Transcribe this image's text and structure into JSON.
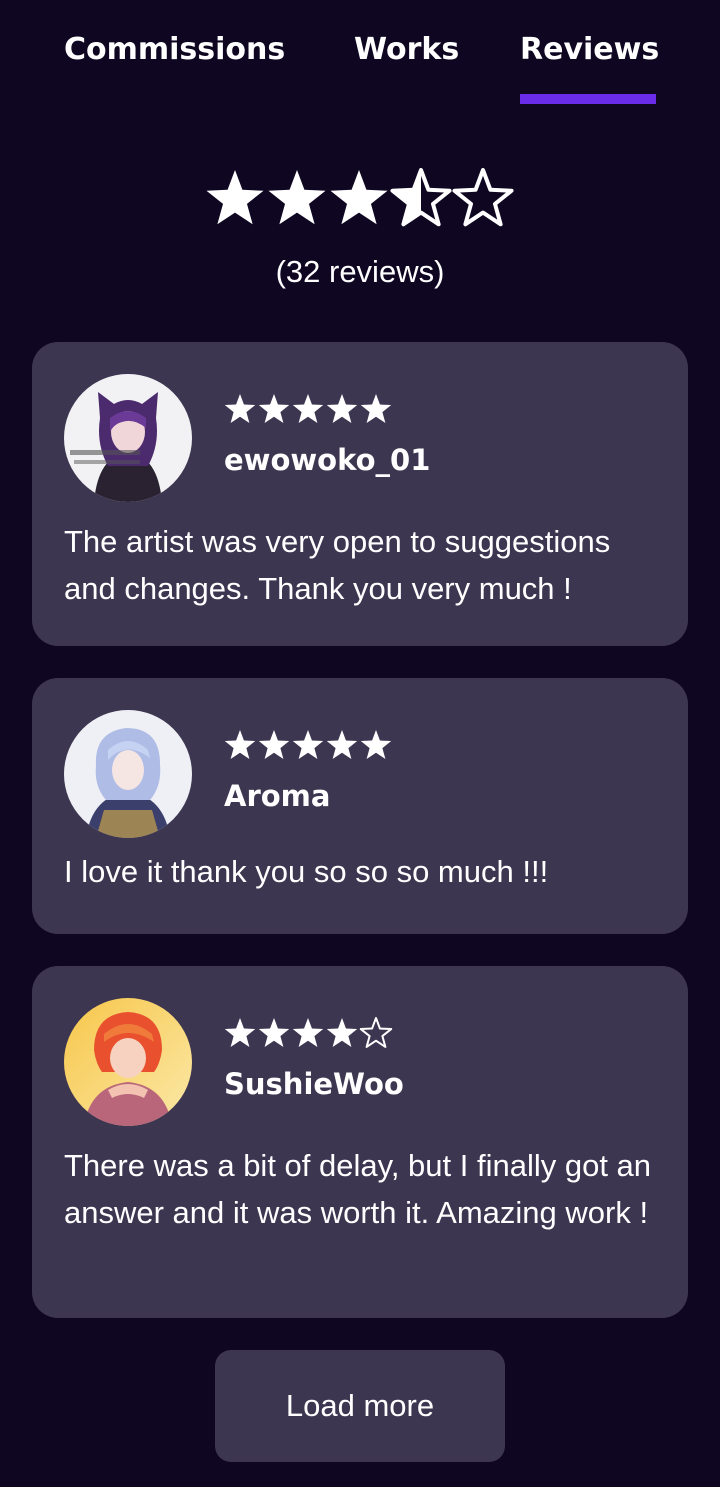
{
  "tabs": {
    "commissions": "Commissions",
    "works": "Works",
    "reviews": "Reviews",
    "active": "Reviews"
  },
  "colors": {
    "background": "#0f0722",
    "card": "#3d3650",
    "accent": "#6a2ce8",
    "text": "#ffffff"
  },
  "summary": {
    "rating": 3.5,
    "max_rating": 5,
    "count_label": "(32 reviews)"
  },
  "reviews": [
    {
      "rating": 5,
      "username": "ewowoko_01",
      "text": "The artist was very open to suggestions and changes. Thank you very much !",
      "avatar": "avatar-purple-hair-hood"
    },
    {
      "rating": 5,
      "username": "Aroma",
      "text": "I love it thank you so so so much !!!",
      "avatar": "avatar-silver-hair"
    },
    {
      "rating": 4,
      "username": "SushieWoo",
      "text": "There was a bit of delay, but I finally got an answer and it was worth it. Amazing work !",
      "avatar": "avatar-orange-hair"
    }
  ],
  "load_more_label": "Load more"
}
